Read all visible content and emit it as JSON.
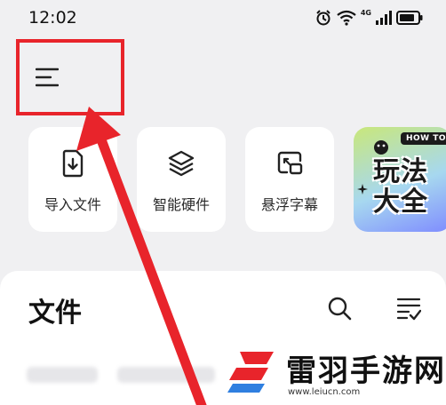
{
  "status_bar": {
    "time": "12:02",
    "network": "4G"
  },
  "header": {
    "menu_icon": "menu-icon"
  },
  "shortcuts": [
    {
      "label": "导入文件",
      "icon": "import-file-icon"
    },
    {
      "label": "智能硬件",
      "icon": "layers-icon"
    },
    {
      "label": "悬浮字幕",
      "icon": "floating-subtitle-icon"
    }
  ],
  "promo": {
    "tag": "HOW TO",
    "line1": "玩法",
    "line2": "大全"
  },
  "files": {
    "title": "文件",
    "search_icon": "search-icon",
    "list_icon": "checklist-icon"
  },
  "watermark": {
    "name": "雷羽手游网",
    "url": "www.leiucn.com"
  },
  "colors": {
    "highlight_red": "#e8242b",
    "background": "#f0f0f2",
    "card": "#ffffff"
  }
}
